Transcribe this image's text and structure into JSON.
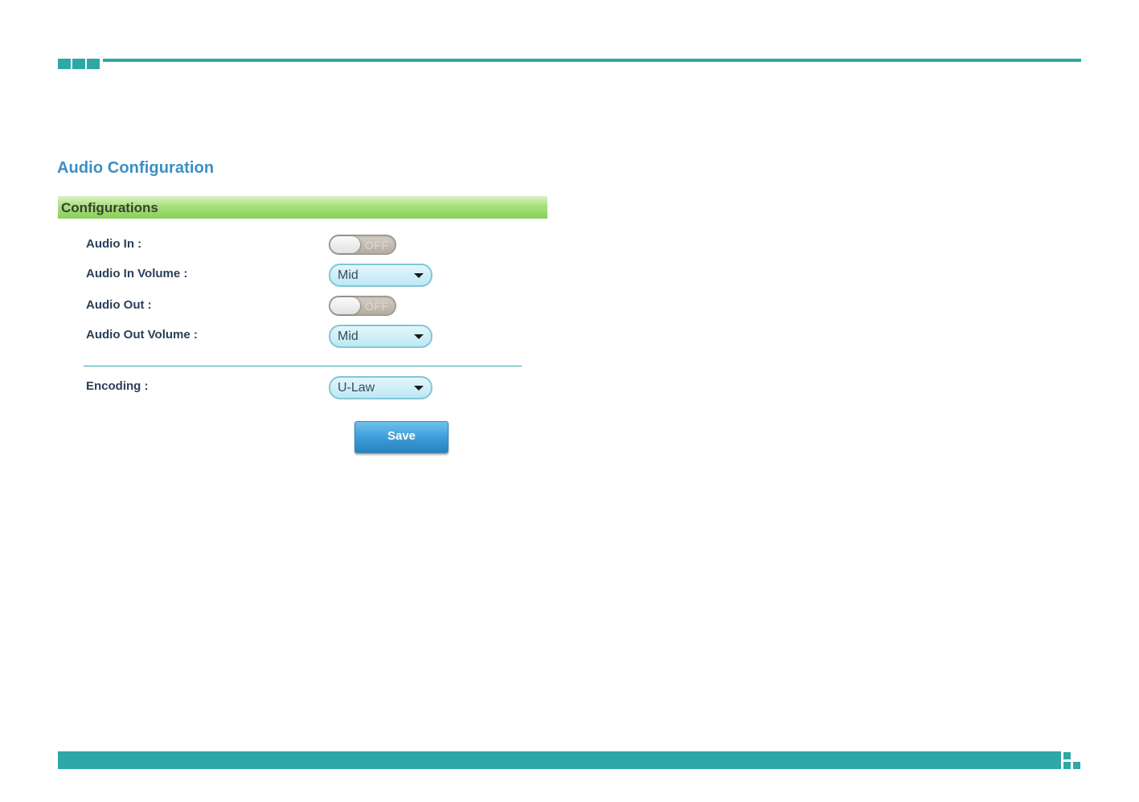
{
  "header": {
    "title": "Audio Configuration"
  },
  "section": {
    "title": "Configurations"
  },
  "rows": {
    "audio_in": {
      "label": "Audio In :",
      "state": "OFF"
    },
    "audio_in_volume": {
      "label": "Audio In Volume :",
      "value": "Mid"
    },
    "audio_out": {
      "label": "Audio Out :",
      "state": "OFF"
    },
    "audio_out_volume": {
      "label": "Audio Out Volume :",
      "value": "Mid"
    },
    "encoding": {
      "label": "Encoding :",
      "value": "U-Law"
    }
  },
  "actions": {
    "save_label": "Save"
  },
  "colors": {
    "accent": "#2ea7a7",
    "title": "#3b8fc4",
    "section_bar": "#a8e07c",
    "button": "#3a9bd6"
  }
}
